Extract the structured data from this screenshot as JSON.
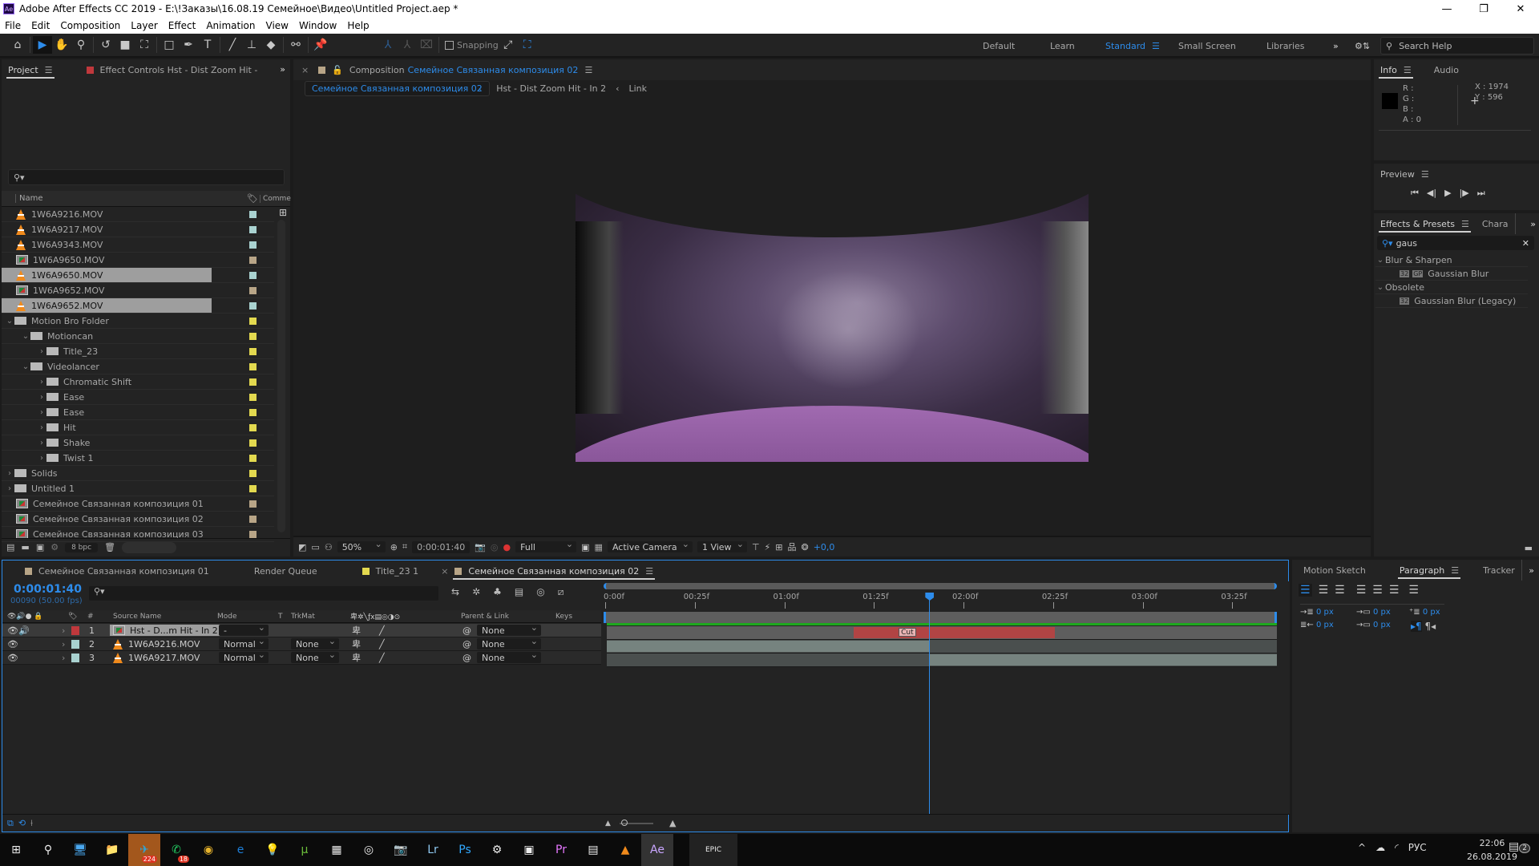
{
  "window": {
    "app_icon": "Ae",
    "title": "Adobe After Effects CC 2019 - E:\\!Заказы\\16.08.19 Семейное\\Видео\\Untitled Project.aep *",
    "controls": [
      "minimize-icon",
      "restore-icon",
      "close-icon"
    ]
  },
  "menu": [
    "File",
    "Edit",
    "Composition",
    "Layer",
    "Effect",
    "Animation",
    "View",
    "Window",
    "Help"
  ],
  "toolbar": {
    "tools": [
      "home-icon",
      "selection-tool-icon",
      "hand-tool-icon",
      "zoom-tool-icon",
      "rotate-tool-icon",
      "camera-tool-icon",
      "pan-behind-tool-icon",
      "shape-tool-icon",
      "pen-tool-icon",
      "type-tool-icon",
      "brush-tool-icon",
      "clone-stamp-icon",
      "eraser-icon",
      "roto-brush-icon",
      "puppet-pin-icon"
    ],
    "snapping_label": "Snapping",
    "workspaces": [
      "Default",
      "Learn",
      "Standard",
      "Small Screen",
      "Libraries"
    ],
    "active_workspace": "Standard",
    "search_help_placeholder": "Search Help"
  },
  "project_panel": {
    "tabs": [
      "Project",
      "Effect Controls Hst - Dist Zoom Hit - In 2"
    ],
    "active_tab": "Project",
    "search_placeholder": "",
    "columns": [
      "Name",
      "Comme"
    ],
    "items": [
      {
        "name": "1W6A9216.MOV",
        "type": "vlc",
        "indent": 0,
        "label_color": "#a9d2d0",
        "selected": false
      },
      {
        "name": "1W6A9217.MOV",
        "type": "vlc",
        "indent": 0,
        "label_color": "#a9d2d0",
        "selected": false
      },
      {
        "name": "1W6A9343.MOV",
        "type": "vlc",
        "indent": 0,
        "label_color": "#a9d2d0",
        "selected": false
      },
      {
        "name": "1W6A9650.MOV",
        "type": "comp",
        "indent": 0,
        "label_color": "#b8a587",
        "selected": false
      },
      {
        "name": "1W6A9650.MOV",
        "type": "vlc",
        "indent": 0,
        "label_color": "#a9d2d0",
        "selected": true
      },
      {
        "name": "1W6A9652.MOV",
        "type": "comp",
        "indent": 0,
        "label_color": "#b8a587",
        "selected": false
      },
      {
        "name": "1W6A9652.MOV",
        "type": "vlc",
        "indent": 0,
        "label_color": "#a9d2d0",
        "selected": true
      },
      {
        "name": "Motion Bro Folder",
        "type": "folder",
        "indent": 0,
        "expanded": true,
        "label_color": "#e3d94f",
        "selected": false
      },
      {
        "name": "Motioncan",
        "type": "folder",
        "indent": 1,
        "expanded": true,
        "label_color": "#e3d94f",
        "selected": false
      },
      {
        "name": "Title_23",
        "type": "folder",
        "indent": 2,
        "expanded": false,
        "label_color": "#e3d94f",
        "selected": false
      },
      {
        "name": "Videolancer",
        "type": "folder",
        "indent": 1,
        "expanded": true,
        "label_color": "#e3d94f",
        "selected": false
      },
      {
        "name": "Chromatic Shift",
        "type": "folder",
        "indent": 2,
        "expanded": false,
        "label_color": "#e3d94f",
        "selected": false
      },
      {
        "name": "Ease",
        "type": "folder",
        "indent": 2,
        "expanded": false,
        "label_color": "#e3d94f",
        "selected": false
      },
      {
        "name": "Ease",
        "type": "folder",
        "indent": 2,
        "expanded": false,
        "label_color": "#e3d94f",
        "selected": false
      },
      {
        "name": "Hit",
        "type": "folder",
        "indent": 2,
        "expanded": false,
        "label_color": "#e3d94f",
        "selected": false
      },
      {
        "name": "Shake",
        "type": "folder",
        "indent": 2,
        "expanded": false,
        "label_color": "#e3d94f",
        "selected": false
      },
      {
        "name": "Twist 1",
        "type": "folder",
        "indent": 2,
        "expanded": false,
        "label_color": "#e3d94f",
        "selected": false
      },
      {
        "name": "Solids",
        "type": "folder",
        "indent": 0,
        "expanded": false,
        "label_color": "#e3d94f",
        "selected": false
      },
      {
        "name": "Untitled 1",
        "type": "folder",
        "indent": 0,
        "expanded": false,
        "label_color": "#e3d94f",
        "selected": false
      },
      {
        "name": "Семейное Связанная композиция 01",
        "type": "comp",
        "indent": 0,
        "label_color": "#b8a587",
        "selected": false
      },
      {
        "name": "Семейное Связанная композиция 02",
        "type": "comp",
        "indent": 0,
        "label_color": "#b8a587",
        "selected": false
      },
      {
        "name": "Семейное Связанная композиция 03",
        "type": "comp",
        "indent": 0,
        "label_color": "#b8a587",
        "selected": false
      }
    ],
    "footer": {
      "bpc": "8 bpc"
    }
  },
  "composition_panel": {
    "tab_prefix": "Composition",
    "tab_name": "Семейное Связанная композиция 02",
    "breadcrumbs": [
      "Семейное Связанная композиция 02",
      "Hst - Dist Zoom Hit - In 2",
      "Link"
    ],
    "footer": {
      "zoom": "50%",
      "timecode": "0:00:01:40",
      "resolution": "Full",
      "camera": "Active Camera",
      "views": "1 View",
      "exposure": "+0,0"
    }
  },
  "info_panel": {
    "tabs": [
      "Info",
      "Audio"
    ],
    "r": "R :",
    "g": "G :",
    "b": "B :",
    "a": "A :  0",
    "x": "X : 1974",
    "y": "Y :  596"
  },
  "preview_panel": {
    "title": "Preview"
  },
  "effects_panel": {
    "tabs": [
      "Effects & Presets",
      "Chara"
    ],
    "search_value": "gaus",
    "groups": [
      {
        "name": "Blur & Sharpen",
        "items": [
          "Gaussian Blur"
        ]
      },
      {
        "name": "Obsolete",
        "items": [
          "Gaussian Blur (Legacy)"
        ]
      }
    ]
  },
  "timeline": {
    "tabs": [
      {
        "label": "Семейное Связанная композиция 01",
        "color": "#b8a587",
        "active": false
      },
      {
        "label": "Render Queue",
        "color": null,
        "active": false
      },
      {
        "label": "Title_23 1",
        "color": "#e3d94f",
        "active": false
      },
      {
        "label": "Семейное Связанная композиция 02",
        "color": "#b8a587",
        "active": true
      }
    ],
    "current_time": "0:00:01:40",
    "frame_info": "00090 (50.00 fps)",
    "columns": {
      "num": "#",
      "source": "Source Name",
      "mode": "Mode",
      "t": "T",
      "trkmat": "TrkMat",
      "parent": "Parent & Link",
      "keys": "Keys"
    },
    "layers": [
      {
        "num": "1",
        "name": "Hst - D...m Hit - In 2",
        "type": "comp",
        "color": "#c0383c",
        "mode": "-",
        "trkmat": "",
        "parent": "None",
        "selected": true
      },
      {
        "num": "2",
        "name": "1W6A9216.MOV",
        "type": "vlc",
        "color": "#a9d2d0",
        "mode": "Normal",
        "trkmat": "None",
        "parent": "None",
        "selected": false
      },
      {
        "num": "3",
        "name": "1W6A9217.MOV",
        "type": "vlc",
        "color": "#a9d2d0",
        "mode": "Normal",
        "trkmat": "None",
        "parent": "None",
        "selected": false
      }
    ],
    "ruler_ticks": [
      "0:00f",
      "00:25f",
      "01:00f",
      "01:25f",
      "02:00f",
      "02:25f",
      "03:00f",
      "03:25f"
    ],
    "duration_frames": 187,
    "playhead_frame": 90,
    "layer_bars": [
      {
        "start": 69,
        "end": 125,
        "color": "#b14444",
        "marker": "Cut",
        "marker_frame": 81
      },
      {
        "start": 0,
        "end": 90,
        "color": "#76837f"
      },
      {
        "start": 90,
        "end": 187,
        "color": "#76837f"
      }
    ]
  },
  "paragraph_panel": {
    "tabs": [
      "Motion Sketch",
      "Paragraph",
      "Tracker"
    ],
    "active_tab": "Paragraph",
    "indent_values": [
      "0 px",
      "0 px",
      "0 px",
      "0 px",
      "0 px"
    ]
  },
  "taskbar": {
    "apps": [
      "start-icon",
      "search-icon",
      "explorer-pc-icon",
      "file-explorer-icon",
      "telegram-icon",
      "whatsapp-icon",
      "chrome-icon",
      "edge-icon",
      "keep-icon",
      "utorrent-icon",
      "winrar-icon",
      "app-icon",
      "camera-app-icon",
      "lightroom-icon",
      "photoshop-icon",
      "settings-icon",
      "control-panel-icon",
      "premiere-icon",
      "monitor-icon",
      "vlc-icon",
      "after-effects-icon",
      "epic-games-icon"
    ],
    "telegram_badge": "224",
    "whatsapp_badge": "18",
    "language": "РУС",
    "time": "22:06",
    "date": "26.08.2019",
    "notification_count": "2"
  }
}
